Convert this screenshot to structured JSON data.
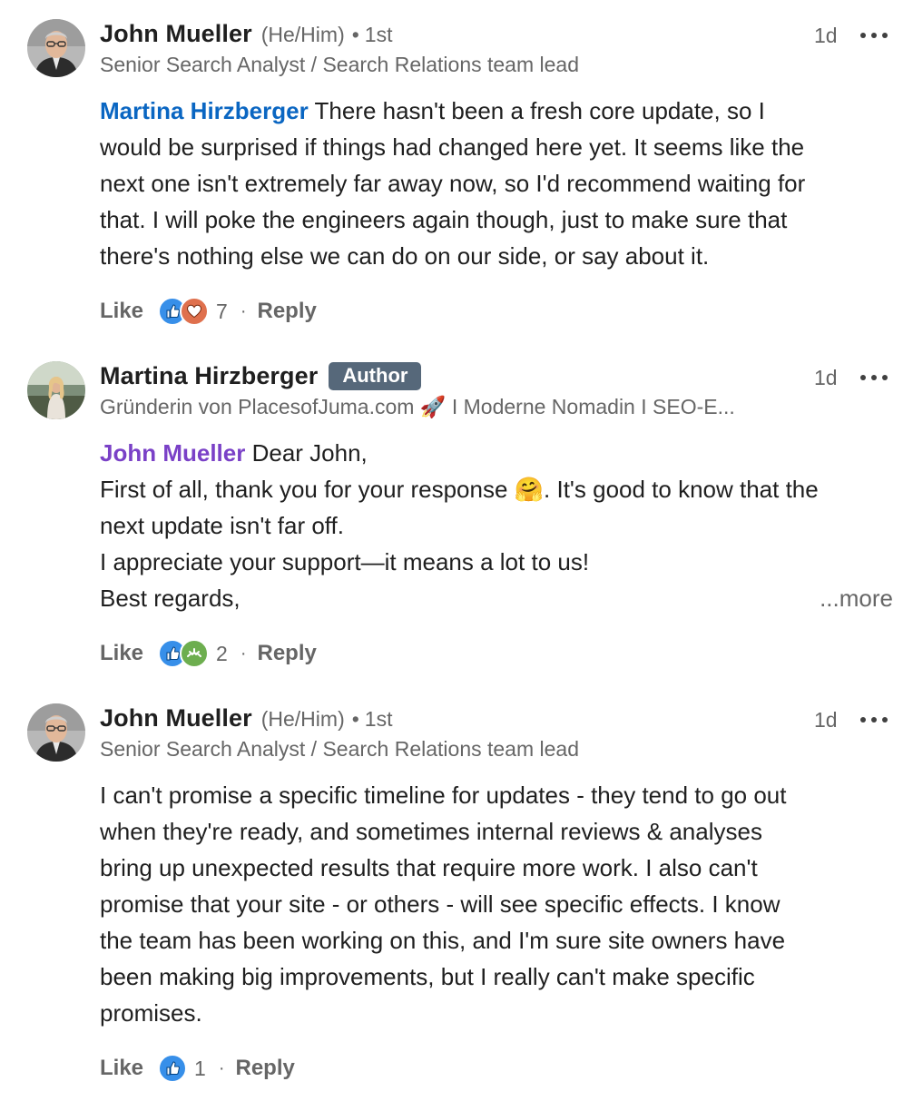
{
  "comments": [
    {
      "author": "John Mueller",
      "pronouns": "(He/Him)",
      "degree": "1st",
      "headline": "Senior Search Analyst / Search Relations team lead",
      "time": "1d",
      "mention": "Martina Hirzberger",
      "text_lines": [
        " There hasn't been a fresh core update, so I",
        "would be surprised if things had changed here yet. It seems like the",
        "next one isn't extremely far away now, so I'd recommend waiting for",
        "that. I will poke the engineers again though, just to make sure that",
        "there's nothing else we can do on our side, or say about it."
      ],
      "like_label": "Like",
      "reactions": [
        "like-icon",
        "love-icon"
      ],
      "reaction_count": "7",
      "reply_label": "Reply"
    },
    {
      "author": "Martina Hirzberger",
      "badge": "Author",
      "headline": "Gründerin von PlacesofJuma.com 🚀 I Moderne Nomadin I SEO-E...",
      "time": "1d",
      "mention": "John Mueller",
      "text_lines": [
        " Dear John,",
        "First of all, thank you for your response 🤗. It's good to know that the",
        "next update isn't far off.",
        "I appreciate your support—it means a lot to us!",
        "Best regards,"
      ],
      "see_more": "...more",
      "like_label": "Like",
      "reactions": [
        "like-icon",
        "support-icon"
      ],
      "reaction_count": "2",
      "reply_label": "Reply"
    },
    {
      "author": "John Mueller",
      "pronouns": "(He/Him)",
      "degree": "1st",
      "headline": "Senior Search Analyst / Search Relations team lead",
      "time": "1d",
      "text_lines": [
        "I can't promise a specific timeline for updates - they tend to go out",
        "when they're ready, and sometimes internal reviews & analyses",
        "bring up unexpected results that require more work. I also can't",
        "promise that your site - or others - will see specific effects. I know",
        "the team has been working on this, and I'm sure site owners have",
        "been making big improvements, but I really can't make specific",
        "promises."
      ],
      "like_label": "Like",
      "reactions": [
        "like-icon"
      ],
      "reaction_count": "1",
      "reply_label": "Reply"
    }
  ],
  "colors": {
    "mention_blue": "#0a66c2",
    "mention_purple": "#7a41c7",
    "badge_bg": "#56687a",
    "secondary_text": "#666666"
  }
}
